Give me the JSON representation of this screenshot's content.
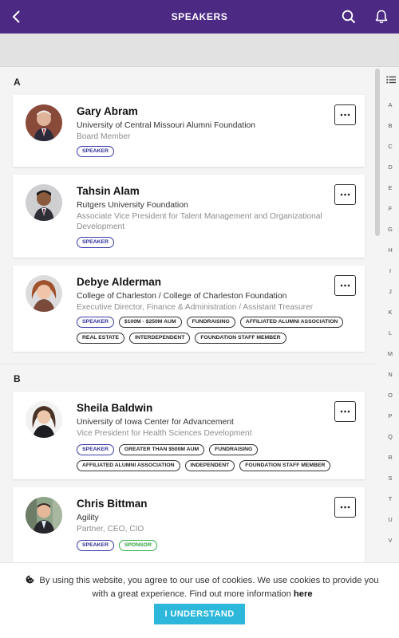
{
  "header": {
    "title": "SPEAKERS",
    "back_icon": "chevron-left-icon",
    "search_icon": "search-icon",
    "bell_icon": "bell-icon",
    "background_color": "#4c2a84"
  },
  "sections": [
    {
      "letter": "A",
      "speakers": [
        {
          "name": "Gary Abram",
          "organization": "University of Central Missouri Alumni Foundation",
          "role": "Board Member",
          "tags": [
            "SPEAKER"
          ]
        },
        {
          "name": "Tahsin Alam",
          "organization": "Rutgers University Foundation",
          "role": "Associate Vice President for Talent Management and Organizational Development",
          "tags": [
            "SPEAKER"
          ]
        },
        {
          "name": "Debye Alderman",
          "organization": "College of Charleston / College of Charleston Foundation",
          "role": "Executive Director, Finance & Administration / Assistant Treasurer",
          "tags": [
            "SPEAKER",
            "$100M - $250M AUM",
            "FUNDRAISING",
            "AFFILIATED ALUMNI ASSOCIATION",
            "REAL ESTATE",
            "INTERDEPENDENT",
            "FOUNDATION STAFF MEMBER"
          ]
        }
      ]
    },
    {
      "letter": "B",
      "speakers": [
        {
          "name": "Sheila Baldwin",
          "organization": "University of Iowa Center for Advancement",
          "role": "Vice President for Health Sciences Development",
          "tags": [
            "SPEAKER",
            "GREATER THAN $500M AUM",
            "FUNDRAISING",
            "AFFILIATED ALUMNI ASSOCIATION",
            "INDEPENDENT",
            "FOUNDATION STAFF MEMBER"
          ]
        },
        {
          "name": "Chris Bittman",
          "organization": "Agility",
          "role": "Partner, CEO, CIO",
          "tags": [
            "SPEAKER",
            "SPONSOR"
          ]
        }
      ]
    }
  ],
  "alphabet_index": [
    "A",
    "B",
    "C",
    "D",
    "E",
    "F",
    "G",
    "H",
    "I",
    "J",
    "K",
    "L",
    "M",
    "N",
    "O",
    "P",
    "Q",
    "R",
    "S",
    "T",
    "U",
    "V"
  ],
  "cookie_banner": {
    "icon": "cookie-icon",
    "text": "By using this website, you agree to our use of cookies. We use cookies to provide you with a great experience. Find out more information ",
    "link_text": "here",
    "button_label": "I UNDERSTAND",
    "button_color": "#2db7db"
  },
  "colors": {
    "speaker_tag": "#2e2e9a",
    "sponsor_tag": "#27a23e"
  }
}
